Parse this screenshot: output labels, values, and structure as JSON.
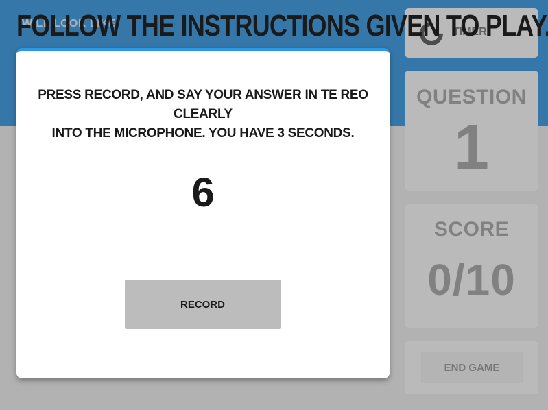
{
  "page": {
    "title": "Follow the instructions given to play."
  },
  "background": {
    "hint_text": "WILL LOOK LIKE"
  },
  "sidebar": {
    "timer_label": "TIMER",
    "question_heading": "QUESTION",
    "question_number": "1",
    "score_heading": "SCORE",
    "score_value": "0/10",
    "end_game_label": "END GAME"
  },
  "modal": {
    "instruction_line1": "Press record, and say your answer in Te Reo clearly",
    "instruction_line2": "into the microphone. You have 3 seconds.",
    "number": "6",
    "record_label": "Record"
  },
  "colors": {
    "accent": "#2e96e6",
    "header_bg": "#1f8ad8",
    "button_gray": "#bcbcbc"
  },
  "icons": {
    "timer": "timer-ring-icon"
  }
}
